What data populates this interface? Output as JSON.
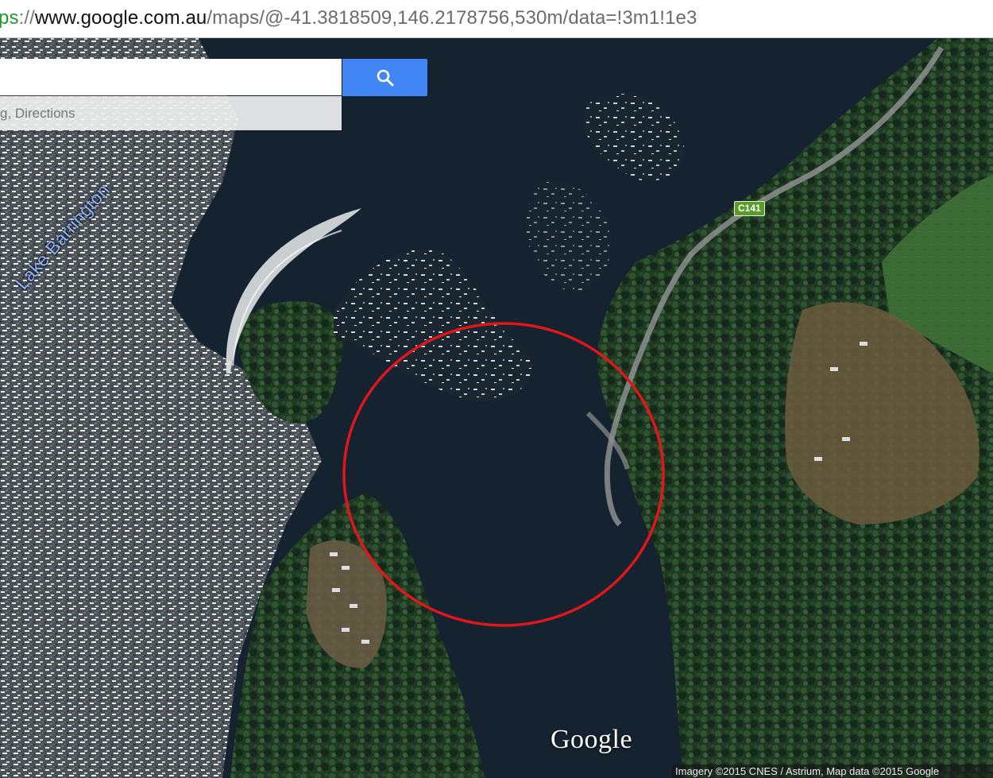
{
  "browser": {
    "url_scheme": "ps",
    "url_sep": "://",
    "url_host": "www.google.com.au",
    "url_path": "/maps/@-41.3818509,146.2178756,530m/data=!3m1!1e3"
  },
  "search": {
    "value": "",
    "hint_text": "g, Directions",
    "button_icon": "search-icon"
  },
  "map": {
    "view": "satellite",
    "lake_label": "Lake Barrington",
    "road_shield": "C141",
    "logo": "Google",
    "attribution": "Imagery ©2015 CNES / Astrium, Map data ©2015 Google",
    "annotation_color": "#e0161b",
    "colors": {
      "water": "#14232f",
      "forest": "#1f3a1f",
      "field": "#3d6a34",
      "search_button": "#4285f4"
    }
  }
}
